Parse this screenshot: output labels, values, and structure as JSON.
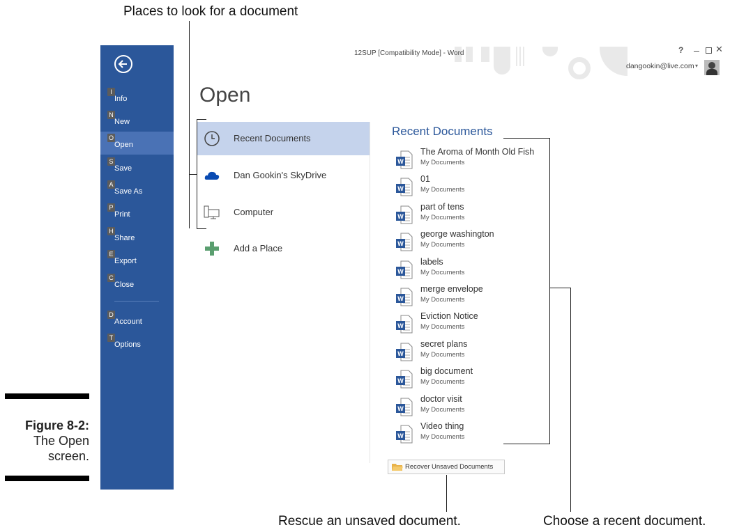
{
  "callouts": {
    "places": "Places to look for a document",
    "rescue": "Rescue an unsaved document.",
    "choose": "Choose a recent document."
  },
  "figure": {
    "label": "Figure 8-2:",
    "caption_line1": "The Open",
    "caption_line2": "screen."
  },
  "window": {
    "title": "12SUP [Compatibility Mode] - Word",
    "help": "?",
    "account": "dangookin@live.com"
  },
  "sidebar": {
    "items": [
      {
        "key": "I",
        "label": "Info"
      },
      {
        "key": "N",
        "label": "New"
      },
      {
        "key": "O",
        "label": "Open"
      },
      {
        "key": "S",
        "label": "Save"
      },
      {
        "key": "A",
        "label": "Save As"
      },
      {
        "key": "P",
        "label": "Print"
      },
      {
        "key": "H",
        "label": "Share"
      },
      {
        "key": "E",
        "label": "Export"
      },
      {
        "key": "C",
        "label": "Close"
      },
      {
        "key": "D",
        "label": "Account"
      },
      {
        "key": "T",
        "label": "Options"
      }
    ],
    "selected": "Open"
  },
  "main": {
    "heading": "Open",
    "places": [
      {
        "label": "Recent Documents",
        "icon": "clock-icon"
      },
      {
        "label": "Dan Gookin's SkyDrive",
        "icon": "cloud-icon"
      },
      {
        "label": "Computer",
        "icon": "computer-icon"
      },
      {
        "label": "Add a Place",
        "icon": "plus-icon"
      }
    ],
    "recent_heading": "Recent Documents",
    "recent_docs": [
      {
        "name": "The Aroma of Month Old Fish",
        "path": "My Documents"
      },
      {
        "name": "01",
        "path": "My Documents"
      },
      {
        "name": "part of tens",
        "path": "My Documents"
      },
      {
        "name": "george washington",
        "path": "My Documents"
      },
      {
        "name": "labels",
        "path": "My Documents"
      },
      {
        "name": "merge envelope",
        "path": "My Documents"
      },
      {
        "name": "Eviction Notice",
        "path": "My Documents"
      },
      {
        "name": "secret plans",
        "path": "My Documents"
      },
      {
        "name": "big document",
        "path": "My Documents"
      },
      {
        "name": "doctor visit",
        "path": "My Documents"
      },
      {
        "name": "Video thing",
        "path": "My Documents"
      }
    ],
    "recover_label": "Recover Unsaved Documents"
  },
  "colors": {
    "sidebar": "#2b579a",
    "sidebar_selected": "#4a72b5",
    "place_selected": "#c5d3ec",
    "word_icon": "#2b579a"
  }
}
